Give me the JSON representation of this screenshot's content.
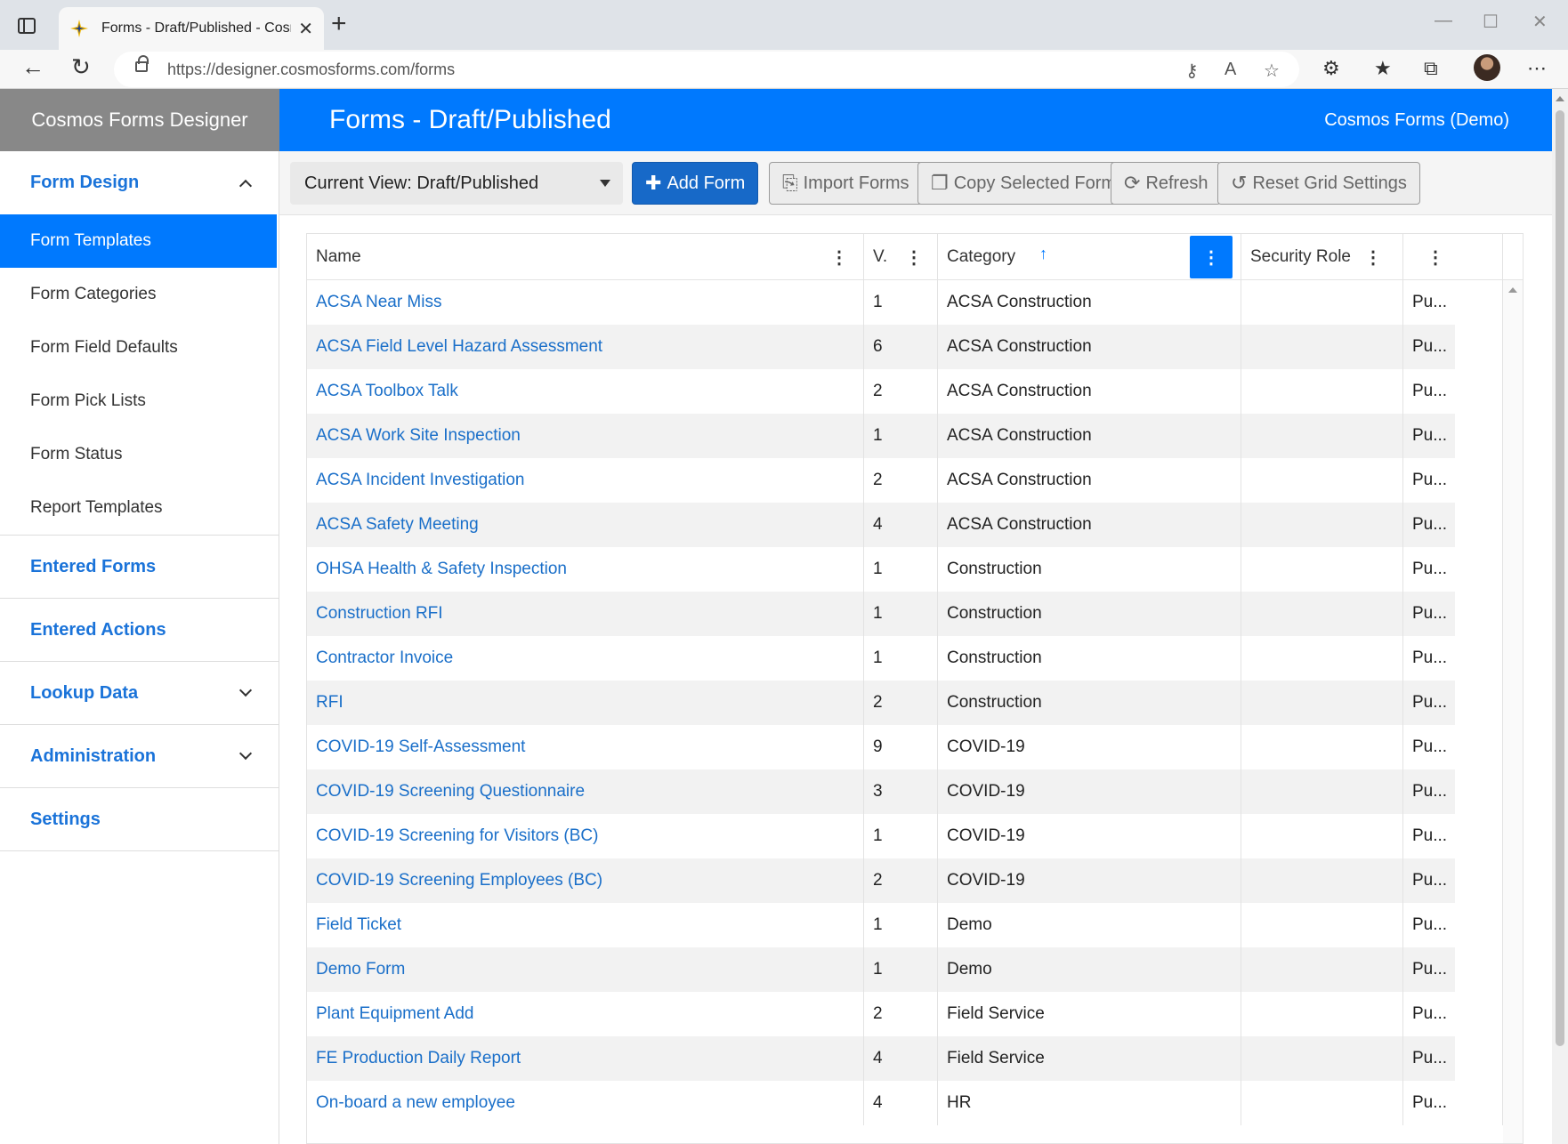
{
  "browser": {
    "tab_title": "Forms - Draft/Published - Cosmo",
    "url": "https://designer.cosmosforms.com/forms"
  },
  "app": {
    "brand": "Cosmos Forms Designer",
    "page_title": "Forms - Draft/Published",
    "org": "Cosmos Forms (Demo)"
  },
  "sidebar": {
    "form_design": "Form Design",
    "items": [
      "Form Templates",
      "Form Categories",
      "Form Field Defaults",
      "Form Pick Lists",
      "Form Status",
      "Report Templates"
    ],
    "entered_forms": "Entered Forms",
    "entered_actions": "Entered Actions",
    "lookup_data": "Lookup Data",
    "administration": "Administration",
    "settings": "Settings"
  },
  "toolbar": {
    "view": "Current View: Draft/Published",
    "add": "Add Form",
    "import": "Import Forms",
    "copy": "Copy Selected Form",
    "refresh": "Refresh",
    "reset": "Reset Grid Settings"
  },
  "grid": {
    "headers": {
      "name": "Name",
      "version": "V.",
      "category": "Category",
      "security": "Security Role"
    },
    "rows": [
      {
        "name": "ACSA Near Miss",
        "v": "1",
        "category": "ACSA Construction",
        "status": "Pu..."
      },
      {
        "name": "ACSA Field Level Hazard Assessment",
        "v": "6",
        "category": "ACSA Construction",
        "status": "Pu..."
      },
      {
        "name": "ACSA Toolbox Talk",
        "v": "2",
        "category": "ACSA Construction",
        "status": "Pu..."
      },
      {
        "name": "ACSA Work Site Inspection",
        "v": "1",
        "category": "ACSA Construction",
        "status": "Pu..."
      },
      {
        "name": "ACSA Incident Investigation",
        "v": "2",
        "category": "ACSA Construction",
        "status": "Pu..."
      },
      {
        "name": "ACSA Safety Meeting",
        "v": "4",
        "category": "ACSA Construction",
        "status": "Pu..."
      },
      {
        "name": "OHSA Health & Safety Inspection",
        "v": "1",
        "category": "Construction",
        "status": "Pu..."
      },
      {
        "name": "Construction RFI",
        "v": "1",
        "category": "Construction",
        "status": "Pu..."
      },
      {
        "name": "Contractor Invoice",
        "v": "1",
        "category": "Construction",
        "status": "Pu..."
      },
      {
        "name": "RFI",
        "v": "2",
        "category": "Construction",
        "status": "Pu..."
      },
      {
        "name": "COVID-19 Self-Assessment",
        "v": "9",
        "category": "COVID-19",
        "status": "Pu..."
      },
      {
        "name": "COVID-19 Screening Questionnaire",
        "v": "3",
        "category": "COVID-19",
        "status": "Pu..."
      },
      {
        "name": "COVID-19 Screening for Visitors (BC)",
        "v": "1",
        "category": "COVID-19",
        "status": "Pu..."
      },
      {
        "name": "COVID-19 Screening Employees (BC)",
        "v": "2",
        "category": "COVID-19",
        "status": "Pu..."
      },
      {
        "name": "Field Ticket",
        "v": "1",
        "category": "Demo",
        "status": "Pu..."
      },
      {
        "name": "Demo Form",
        "v": "1",
        "category": "Demo",
        "status": "Pu..."
      },
      {
        "name": "Plant Equipment Add",
        "v": "2",
        "category": "Field Service",
        "status": "Pu..."
      },
      {
        "name": "FE Production Daily Report",
        "v": "4",
        "category": "Field Service",
        "status": "Pu..."
      },
      {
        "name": "On-board a new employee",
        "v": "4",
        "category": "HR",
        "status": "Pu..."
      }
    ]
  }
}
